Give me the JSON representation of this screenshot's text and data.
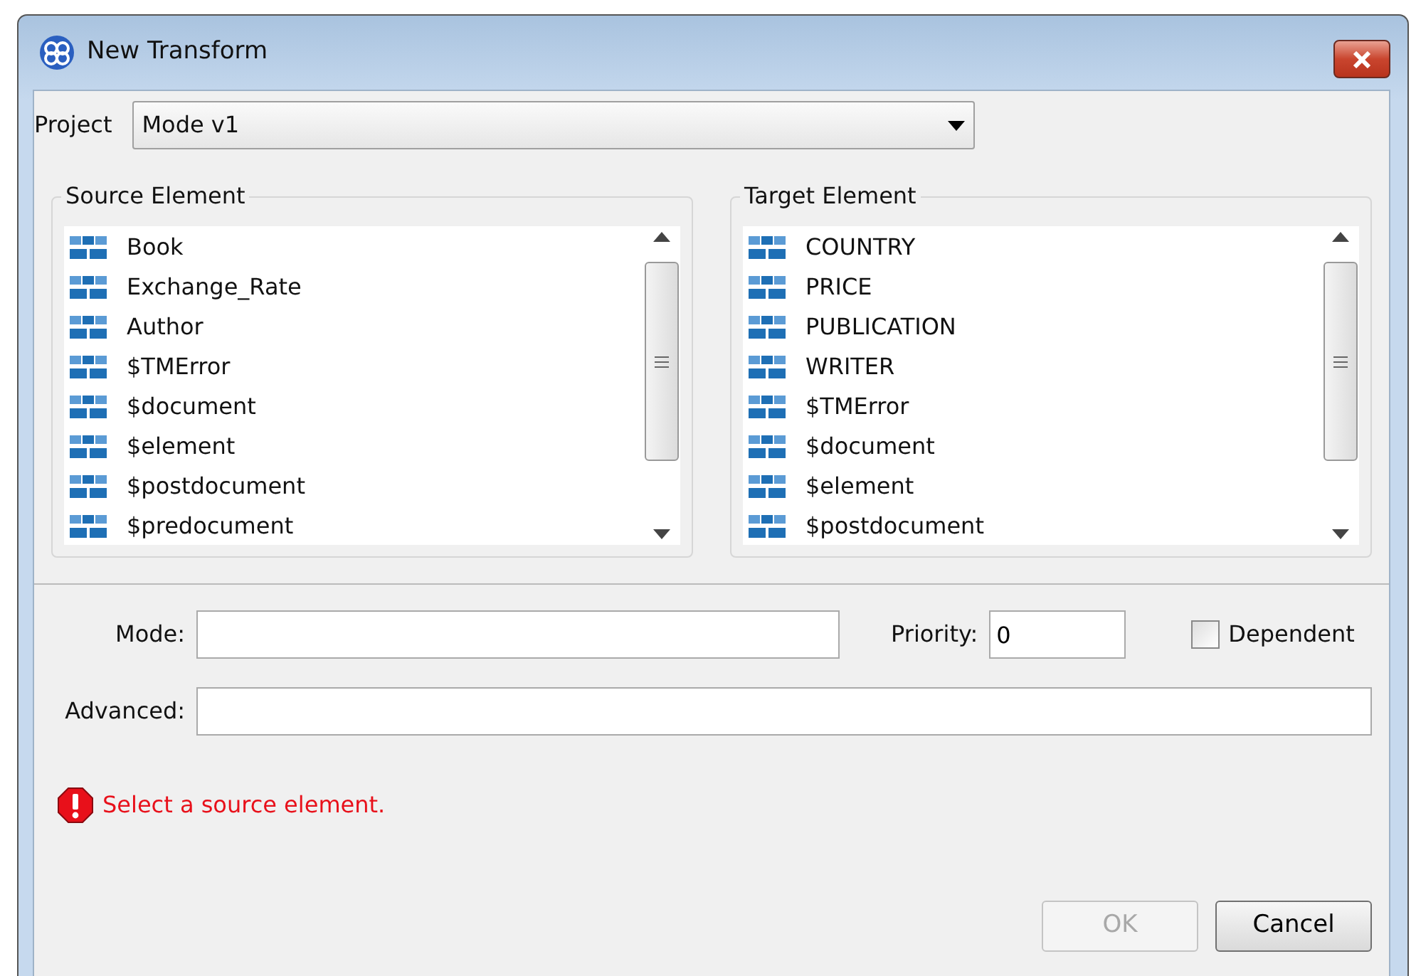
{
  "window": {
    "title": "New Transform"
  },
  "project": {
    "label": "Project",
    "value": "Mode v1"
  },
  "source": {
    "title": "Source Element",
    "items": [
      "Book",
      "Exchange_Rate",
      "Author",
      "$TMError",
      "$document",
      "$element",
      "$postdocument",
      "$predocument"
    ]
  },
  "target": {
    "title": "Target Element",
    "items": [
      "COUNTRY",
      "PRICE",
      "PUBLICATION",
      "WRITER",
      "$TMError",
      "$document",
      "$element",
      "$postdocument"
    ]
  },
  "mode": {
    "label": "Mode:"
  },
  "priority": {
    "label": "Priority:",
    "value": "0"
  },
  "dependent": {
    "label": "Dependent",
    "checked": false
  },
  "advanced": {
    "label": "Advanced:"
  },
  "message": {
    "kind": "error",
    "text": "Select a source element."
  },
  "buttons": [
    {
      "label": "OK",
      "disabled": true
    },
    {
      "label": "Cancel",
      "disabled": false
    }
  ]
}
